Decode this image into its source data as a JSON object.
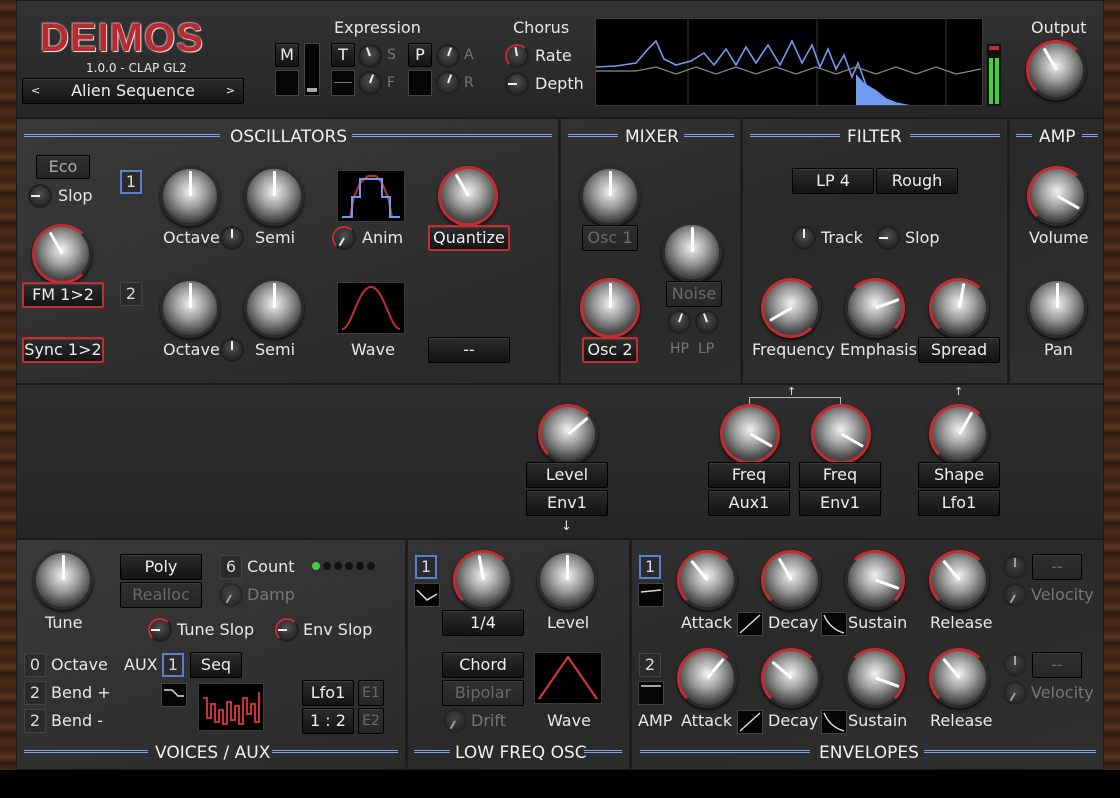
{
  "header": {
    "logo": "DEIMOS",
    "version": "1.0.0 - CLAP GL2",
    "preset": "Alien Sequence",
    "prev": "<",
    "next": ">",
    "expression": "Expression",
    "m": "M",
    "t": "T",
    "s": "S",
    "f": "F",
    "p": "P",
    "a": "A",
    "r": "R",
    "chorus": "Chorus",
    "rate": "Rate",
    "depth": "Depth",
    "output": "Output"
  },
  "osc": {
    "title": "OSCILLATORS",
    "eco": "Eco",
    "slop": "Slop",
    "fm": "FM 1>2",
    "sync": "Sync 1>2",
    "n1": "1",
    "n2": "2",
    "octave": "Octave",
    "semi": "Semi",
    "anim": "Anim",
    "quantize": "Quantize",
    "wave": "Wave",
    "empty": "--"
  },
  "mixer": {
    "title": "MIXER",
    "osc1": "Osc 1",
    "osc2": "Osc 2",
    "noise": "Noise",
    "hp": "HP",
    "lp": "LP"
  },
  "filter": {
    "title": "FILTER",
    "mode": "LP 4",
    "char": "Rough",
    "track": "Track",
    "slop": "Slop",
    "frequency": "Frequency",
    "emphasis": "Emphasis",
    "spread": "Spread"
  },
  "amp": {
    "title": "AMP",
    "volume": "Volume",
    "pan": "Pan"
  },
  "mod": {
    "level": "Level",
    "env1": "Env1",
    "freq": "Freq",
    "aux1": "Aux1",
    "freq2": "Freq",
    "env1b": "Env1",
    "shape": "Shape",
    "lfo1": "Lfo1",
    "up": "↑",
    "down": "↓"
  },
  "voices": {
    "title": "VOICES / AUX",
    "tune": "Tune",
    "poly": "Poly",
    "realloc": "Realloc",
    "count_val": "6",
    "count": "Count",
    "damp": "Damp",
    "tuneslop": "Tune Slop",
    "envslop": "Env Slop",
    "oct_val": "0",
    "octave": "Octave",
    "bendp_val": "2",
    "bendp": "Bend +",
    "bendm_val": "2",
    "bendm": "Bend -",
    "aux": "AUX",
    "aux_val": "1",
    "seq": "Seq",
    "lfo1": "Lfo1",
    "e1": "E1",
    "ratio": "1 : 2",
    "e2": "E2"
  },
  "lfo": {
    "title": "LOW FREQ OSC",
    "n": "1",
    "rate": "1/4",
    "level": "Level",
    "chord": "Chord",
    "bipolar": "Bipolar",
    "drift": "Drift",
    "wave": "Wave"
  },
  "env": {
    "title": "ENVELOPES",
    "n1": "1",
    "n2": "2",
    "amp": "AMP",
    "attack": "Attack",
    "decay": "Decay",
    "sustain": "Sustain",
    "release": "Release",
    "velocity": "Velocity",
    "empty": "--"
  }
}
